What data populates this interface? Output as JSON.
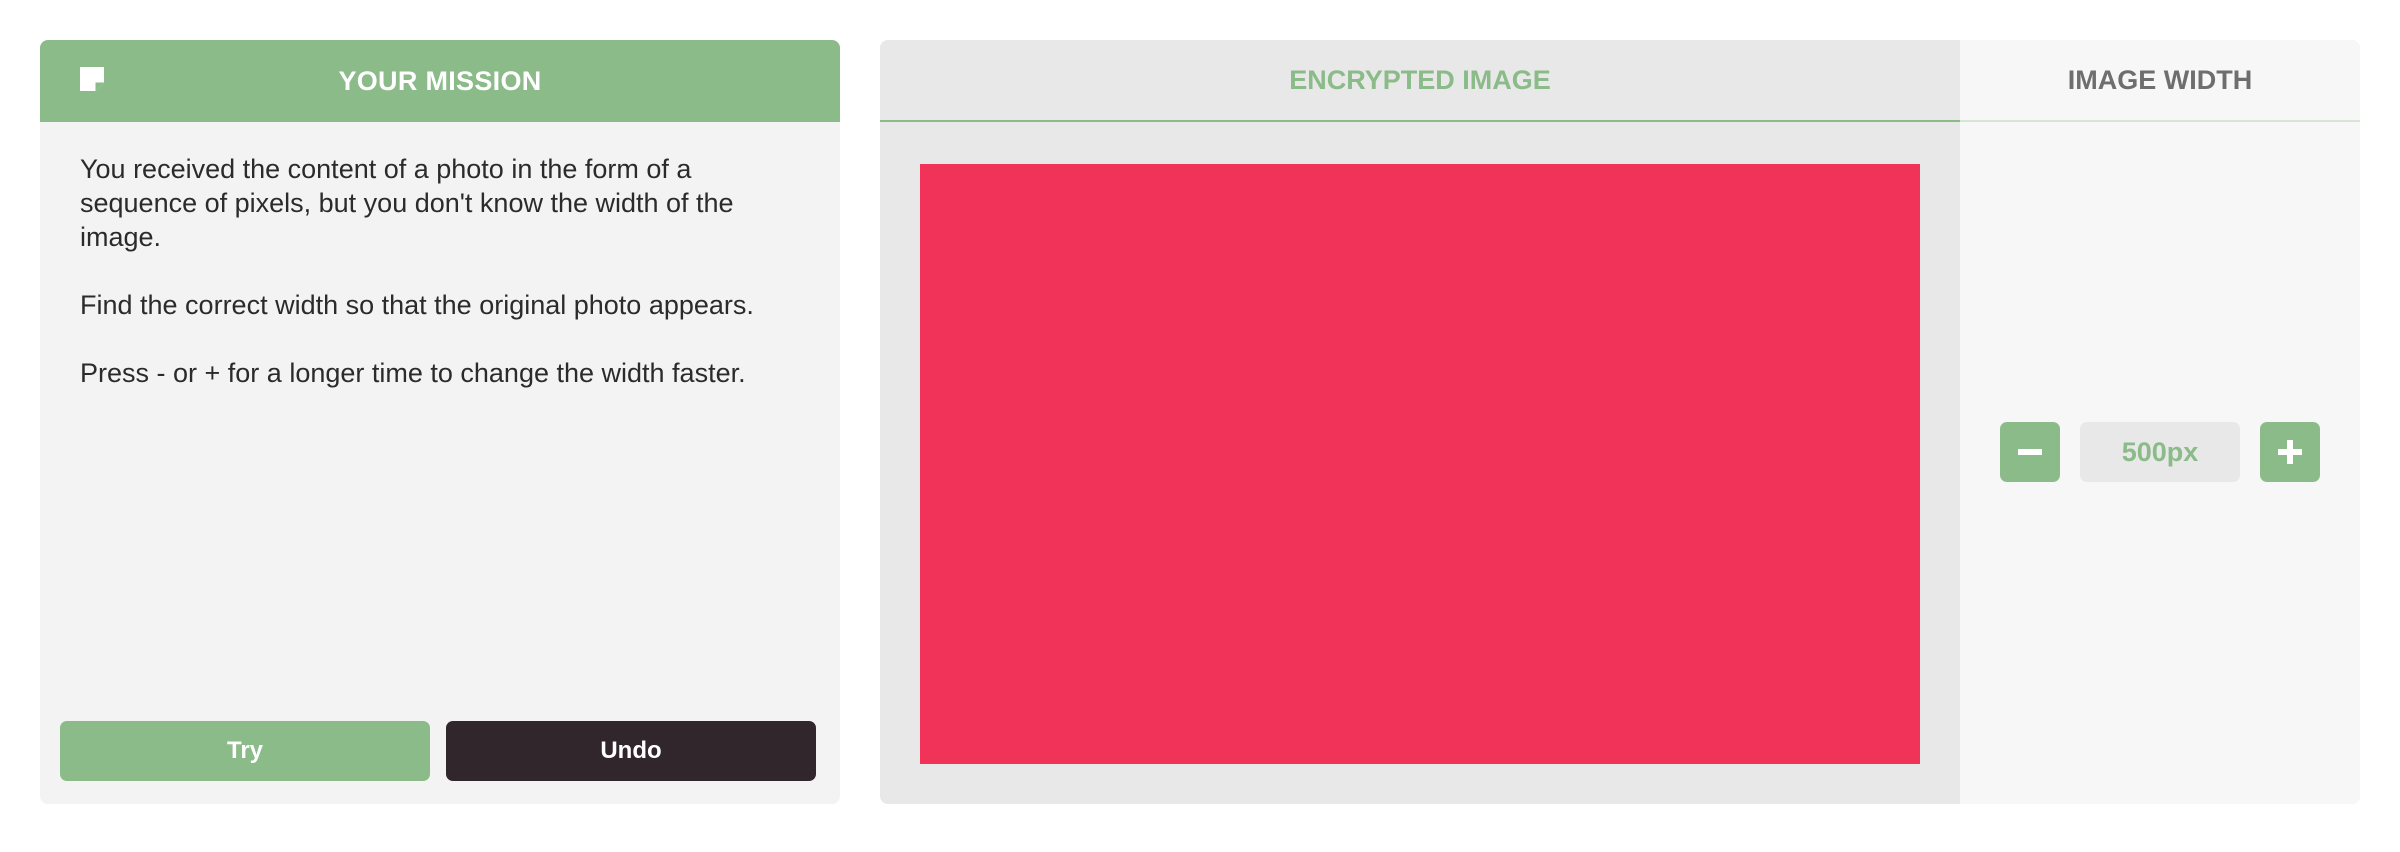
{
  "mission": {
    "title": "YOUR MISSION",
    "icon": "sticky-note-icon",
    "paragraphs": [
      "You received the content of a photo in the form of a sequence of pixels, but you don't know the width of the image.",
      "Find the correct width so that the original photo appears.",
      "Press - or + for a longer time to change the width faster."
    ],
    "try_label": "Try",
    "undo_label": "Undo"
  },
  "workspace": {
    "encrypted_tab_label": "ENCRYPTED IMAGE",
    "image_color": "#f1335a",
    "width_panel": {
      "title": "IMAGE WIDTH",
      "value": "500px",
      "decrease_icon": "minus-icon",
      "increase_icon": "plus-icon"
    }
  },
  "colors": {
    "accent": "#8abb88",
    "dark_button": "#30262c",
    "panel_bg": "#f3f3f3"
  }
}
